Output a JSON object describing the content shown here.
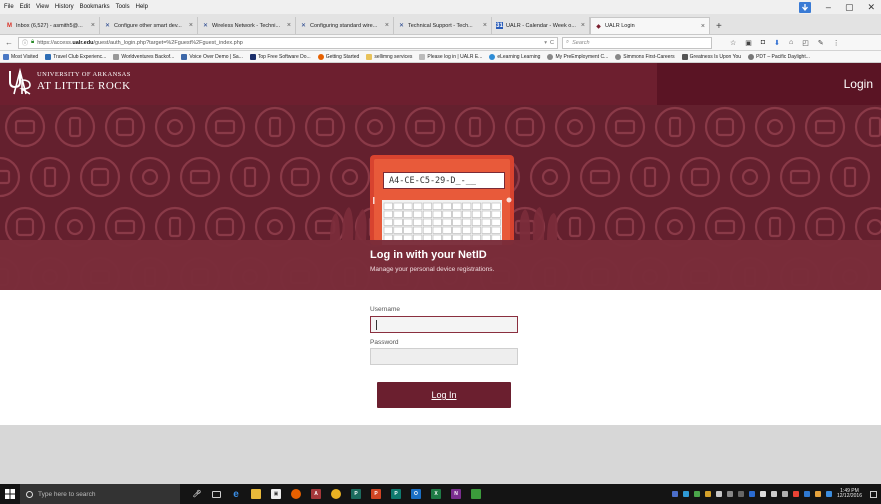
{
  "menu": [
    "File",
    "Edit",
    "View",
    "History",
    "Bookmarks",
    "Tools",
    "Help"
  ],
  "window_controls": [
    "–",
    "▢",
    "✕"
  ],
  "tabs": [
    {
      "label": "Inbox (6,527) - asmith5@...",
      "icon": "gmail-icon"
    },
    {
      "label": "Configure other smart dev...",
      "icon": "x-icon"
    },
    {
      "label": "Wireless Network - Techni...",
      "icon": "x-icon"
    },
    {
      "label": "Configuring standard wire...",
      "icon": "x-icon"
    },
    {
      "label": "Technical Support - Tech...",
      "icon": "x-icon"
    },
    {
      "label": "UALR - Calendar - Week o...",
      "icon": "calendar-icon"
    },
    {
      "label": "UALR Login",
      "icon": "ualr-icon",
      "active": true
    }
  ],
  "new_tab": "+",
  "nav": {
    "url_host": "https://access.",
    "url_domain": "ualr.edu",
    "url_rest": "/guest/auth_login.php?target=%2Fguest%2Fguest_index.php",
    "search_placeholder": "Search"
  },
  "bookmarks": [
    "Most Visited",
    "Travel Club Experienc...",
    "Worldventures Backof...",
    "Voice Over Demo | Sa...",
    "Top Free Software Do...",
    "Getting Started",
    "sellimng services",
    "Please log in | UALR E...",
    "eLearning Learning",
    "My PreEmployment C...",
    "Simmons First-Careers",
    "Greatness Is Upon You",
    "PDT – Pacific Daylight..."
  ],
  "site": {
    "logo_line1": "UNIVERSITY OF ARKANSAS",
    "logo_line2": "AT LITTLE ROCK",
    "login_link": "Login",
    "device_id": "A4-CE-C5-29-D_-__",
    "hero_title": "Log in with your NetID",
    "hero_subtitle": "Manage your personal device registrations.",
    "username_label": "Username",
    "password_label": "Password",
    "login_button": "Log In"
  },
  "taskbar": {
    "search_placeholder": "Type here to search",
    "time": "1:49 PM",
    "date": "12/12/2016"
  },
  "colors": {
    "brand": "#6d1f2f",
    "brand_dark": "#5a1424",
    "hero_band": "#7a2c3a"
  }
}
